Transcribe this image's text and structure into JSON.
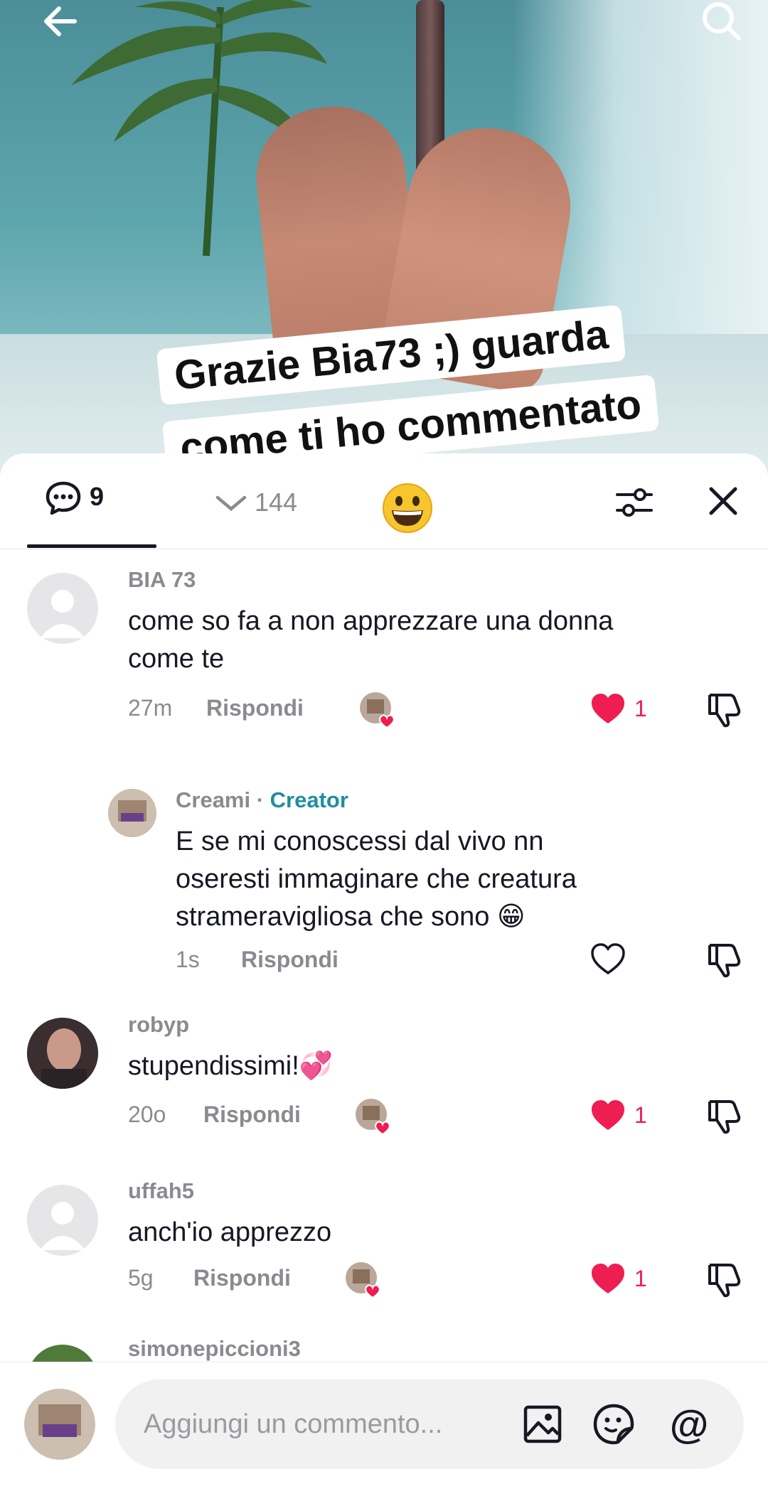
{
  "video": {
    "caption_line1": "Grazie Bia73 ;) guarda",
    "caption_line2": "come ti ho commentato"
  },
  "tabs": {
    "comments_count": "9",
    "likes_count": "144"
  },
  "comments": [
    {
      "username": "BIA 73",
      "text_line1": "come so fa a non apprezzare una donna",
      "text_line2": "come te",
      "time": "27m",
      "reply_label": "Rispondi",
      "likes": "1"
    },
    {
      "username": "Creami",
      "separator": " · ",
      "badge": "Creator",
      "text_line1": "E se mi conoscessi dal vivo nn",
      "text_line2": "oseresti immaginare che creatura",
      "text_line3": "strameravigliosa che sono 😁",
      "time": "1s",
      "reply_label": "Rispondi"
    },
    {
      "username": "robyp",
      "text_line1": "stupendissimi!💞",
      "time": "20o",
      "reply_label": "Rispondi",
      "likes": "1"
    },
    {
      "username": "uffah5",
      "text_line1": "anch'io apprezzo",
      "time": "5g",
      "reply_label": "Rispondi",
      "likes": "1"
    },
    {
      "username": "simonepiccioni3"
    }
  ],
  "composer": {
    "placeholder": "Aggiungi un commento...",
    "mention_symbol": "@"
  },
  "colors": {
    "like_red": "#ee1d52",
    "creator_teal": "#1e8fa0",
    "text_gray": "#8a8b91"
  },
  "icons": [
    "back-arrow-icon",
    "search-icon",
    "comment-bubble-icon",
    "chevron-down-icon",
    "grinning-emoji-icon",
    "filter-icon",
    "close-icon",
    "heart-icon",
    "dislike-icon",
    "image-icon",
    "sticker-icon",
    "at-icon"
  ]
}
